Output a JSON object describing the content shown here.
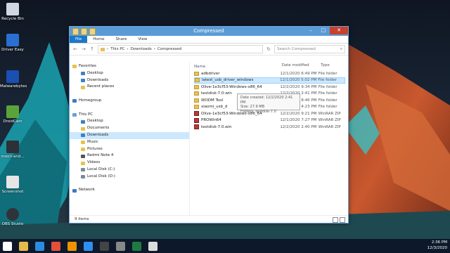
{
  "desktop_icons": [
    {
      "label": "Recycle Bin"
    },
    {
      "label": "Driver Easy"
    },
    {
      "label": "Malwarebytes"
    },
    {
      "label": "DroidCam"
    },
    {
      "label": "moon-and..."
    },
    {
      "label": "Screenshot"
    },
    {
      "label": "OBS Studio"
    }
  ],
  "window": {
    "title": "Compressed",
    "tabs": [
      "File",
      "Home",
      "Share",
      "View"
    ],
    "breadcrumb": [
      "This PC",
      "Downloads",
      "Compressed"
    ],
    "search_placeholder": "Search Compressed",
    "columns": {
      "name": "Name",
      "date": "Date modified",
      "type": "Type"
    },
    "nav": [
      {
        "label": "Favorites",
        "indent": 0,
        "color": "#e7c24a"
      },
      {
        "label": "Desktop",
        "indent": 1,
        "color": "#3b82c4"
      },
      {
        "label": "Downloads",
        "indent": 1,
        "color": "#3b82c4"
      },
      {
        "label": "Recent places",
        "indent": 1,
        "color": "#e7c24a"
      },
      {
        "label": "",
        "indent": 0,
        "color": ""
      },
      {
        "label": "Homegroup",
        "indent": 0,
        "color": "#3e7bc0"
      },
      {
        "label": "",
        "indent": 0,
        "color": ""
      },
      {
        "label": "This PC",
        "indent": 0,
        "color": "#6aa0d8"
      },
      {
        "label": "Desktop",
        "indent": 1,
        "color": "#3b82c4"
      },
      {
        "label": "Documents",
        "indent": 1,
        "color": "#e7c24a"
      },
      {
        "label": "Downloads",
        "indent": 1,
        "color": "#3b82c4",
        "selected": true
      },
      {
        "label": "Music",
        "indent": 1,
        "color": "#e7c24a"
      },
      {
        "label": "Pictures",
        "indent": 1,
        "color": "#e7c24a"
      },
      {
        "label": "Redmi Note 4",
        "indent": 1,
        "color": "#555555"
      },
      {
        "label": "Videos",
        "indent": 1,
        "color": "#e7c24a"
      },
      {
        "label": "Local Disk (C:)",
        "indent": 1,
        "color": "#7a8a9a"
      },
      {
        "label": "Local Disk (D:)",
        "indent": 1,
        "color": "#7a8a9a"
      },
      {
        "label": "",
        "indent": 0,
        "color": ""
      },
      {
        "label": "Network",
        "indent": 0,
        "color": "#3e7bc0"
      }
    ],
    "files": [
      {
        "name": "adbdriver",
        "date": "12/1/2020 6:49 PM",
        "type": "File folder",
        "kind": "folder"
      },
      {
        "name": "latest_usb_driver_windows",
        "date": "12/1/2020 5:02 PM",
        "type": "File folder",
        "kind": "folder",
        "selected": true
      },
      {
        "name": "Olive-1e3cf53-Windows-x86_64",
        "date": "12/2/2020 9:34 PM",
        "type": "File folder",
        "kind": "folder"
      },
      {
        "name": "testdisk-7.0-win",
        "date": "12/2/2020 2:41 PM",
        "type": "File folder",
        "kind": "folder"
      },
      {
        "name": "WODM Tool",
        "date": "12/1/2020 8:46 PM",
        "type": "File folder",
        "kind": "folder"
      },
      {
        "name": "xiaomi_usb_d",
        "date": "12/1/2020 4:23 PM",
        "type": "File folder",
        "kind": "folder"
      },
      {
        "name": "Olive-1e3cf53-Windows-x86_64",
        "date": "12/2/2020 9:21 PM",
        "type": "WinRAR ZIP",
        "kind": "zip"
      },
      {
        "name": "PROWin64",
        "date": "12/1/2020 7:27 PM",
        "type": "WinRAR ZIP",
        "kind": "zip"
      },
      {
        "name": "testdisk-7.0.win",
        "date": "12/2/2020 2:40 PM",
        "type": "WinRAR ZIP",
        "kind": "zip"
      }
    ],
    "tooltip": [
      "Date created: 12/2/2020 2:41 PM",
      "Size: 27.9 MB",
      "Folders: testdisk-7.0"
    ],
    "status": "9 items"
  },
  "taskbar": {
    "apps": [
      {
        "name": "start-button",
        "color": "#ffffff"
      },
      {
        "name": "file-explorer-icon",
        "color": "#e6b94a"
      },
      {
        "name": "ie-icon",
        "color": "#2c8be0"
      },
      {
        "name": "chrome-icon",
        "color": "#e34f3b"
      },
      {
        "name": "illustrator-icon",
        "color": "#f09300"
      },
      {
        "name": "photoshop-icon",
        "color": "#2f8ef0"
      },
      {
        "name": "obs-icon",
        "color": "#444444"
      },
      {
        "name": "camera-icon",
        "color": "#888888"
      },
      {
        "name": "excel-icon",
        "color": "#1e7b40"
      },
      {
        "name": "explorer-active-icon",
        "color": "#dcdcdc"
      }
    ],
    "time": "2:36 PM",
    "date": "12/3/2020"
  }
}
